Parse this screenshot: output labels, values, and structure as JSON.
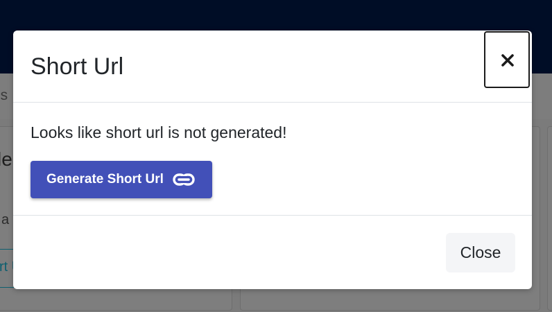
{
  "background": {
    "breadcrumb_fragment": "ls",
    "card_heading_fragment": "le",
    "card_text_fragment": "a",
    "card_button_fragment": "rt U"
  },
  "modal": {
    "title": "Short Url",
    "close_icon": "close-x-icon",
    "body": {
      "message": "Looks like short url is not generated!",
      "generate_button_label": "Generate Short Url",
      "generate_button_icon": "link-icon"
    },
    "footer": {
      "close_button_label": "Close"
    }
  },
  "colors": {
    "header_bar": "#000d26",
    "primary_button": "#4250b8",
    "close_button_bg": "#f4f5f7",
    "background_link": "#0d5f6f"
  }
}
